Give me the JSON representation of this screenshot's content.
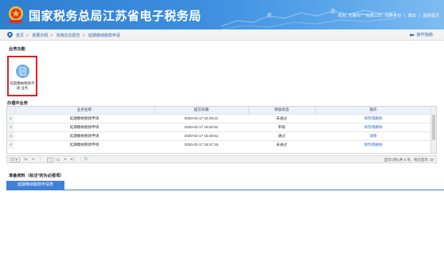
{
  "header": {
    "title": "国家税务总局江苏省电子税务局",
    "emblem_text": "中国税务",
    "user_greeting": "欢迎, 无锡市***有限公司",
    "logout_label": "切换身份",
    "exit_label": "退出",
    "home_label": "返回首页"
  },
  "breadcrumb": {
    "items": [
      "首页",
      "我要办税",
      "资格信息报告",
      "延期缴纳税款申请"
    ],
    "guide_label": "操作指南"
  },
  "functions": {
    "section_title": "业务功能",
    "card_label": "延期缴纳税款申请-业务"
  },
  "records": {
    "section_title": "办理中业务",
    "columns": [
      "业务名称",
      "提交日期",
      "审核状态",
      "操作"
    ],
    "rows": [
      {
        "no": "1",
        "name": "延期缴纳税款申请",
        "date": "2020-02-17 16:29:21",
        "status": "未通过",
        "op": "修改或删除"
      },
      {
        "no": "2",
        "name": "延期缴纳税款申请",
        "date": "2020-02-17 15:52:51",
        "status": "审核",
        "op": "修改或删除"
      },
      {
        "no": "3",
        "name": "延期缴纳税款申请",
        "date": "2020-02-17 15:48:51",
        "status": "通过",
        "op": "详情"
      },
      {
        "no": "4",
        "name": "延期缴纳税款申请",
        "date": "2020-02-17 15:47:15",
        "status": "未通过",
        "op": "修改或删除"
      }
    ]
  },
  "pager": {
    "page_size": "10",
    "current_page": "1",
    "total_pages_text": "/ 1",
    "info": "显示1到5,共 5 条，每页显示: 10"
  },
  "materials": {
    "section_title": "准备资料（标注*的为必报项）",
    "apply_button": "延期缴纳税款申请表"
  },
  "colors": {
    "header_blue": "#2f7fd0",
    "card_border": "#e02020",
    "icon_blue": "#6faee8",
    "button_blue": "#3f80d8"
  }
}
